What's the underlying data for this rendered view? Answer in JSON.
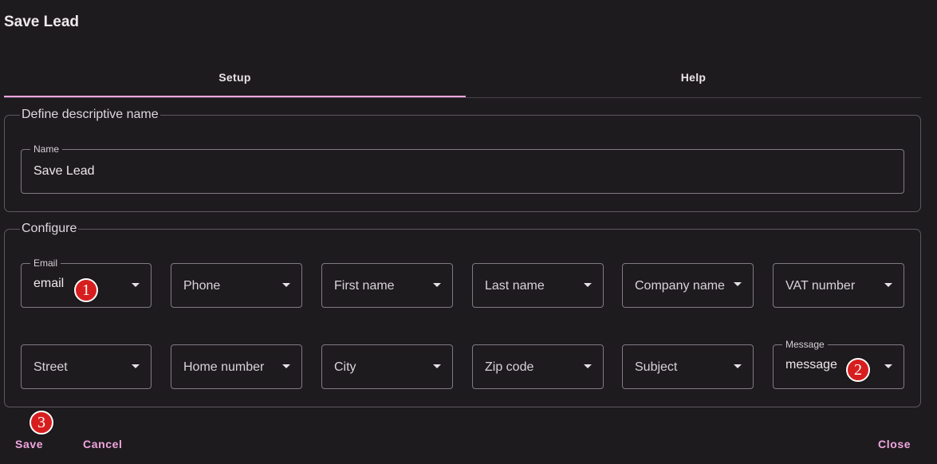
{
  "dialog": {
    "title": "Save Lead"
  },
  "tabs": [
    {
      "label": "Setup",
      "active": true
    },
    {
      "label": "Help",
      "active": false
    }
  ],
  "name_section": {
    "legend": "Define descriptive name",
    "name_field": {
      "label": "Name",
      "value": "Save Lead"
    }
  },
  "configure_section": {
    "legend": "Configure",
    "row1": [
      {
        "label": "Email",
        "value": "email"
      },
      {
        "placeholder": "Phone"
      },
      {
        "placeholder": "First name"
      },
      {
        "placeholder": "Last name"
      },
      {
        "placeholder": "Company name"
      },
      {
        "placeholder": "VAT number"
      }
    ],
    "row2": [
      {
        "placeholder": "Street"
      },
      {
        "placeholder": "Home number"
      },
      {
        "placeholder": "City"
      },
      {
        "placeholder": "Zip code"
      },
      {
        "placeholder": "Subject"
      },
      {
        "label": "Message",
        "value": "message"
      }
    ]
  },
  "markers": [
    "1",
    "2",
    "3"
  ],
  "actions": {
    "save": "Save",
    "cancel": "Cancel",
    "close": "Close"
  },
  "colors": {
    "background": "#1e1b1f",
    "accent": "#f0a6de",
    "marker": "#d71e1e"
  }
}
